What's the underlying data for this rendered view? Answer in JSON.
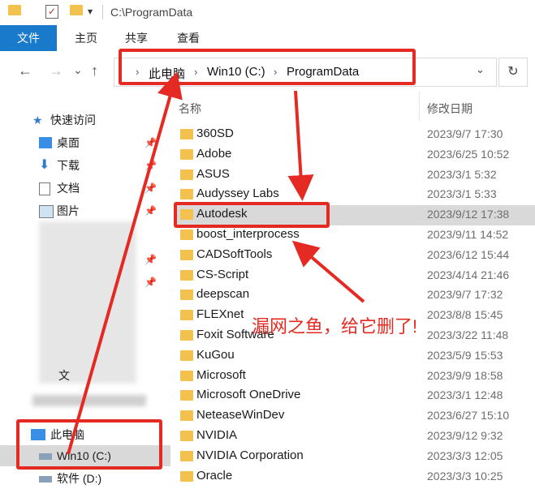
{
  "titlebar": {
    "path": "C:\\ProgramData"
  },
  "ribbon": {
    "tabs": [
      "文件",
      "主页",
      "共享",
      "查看"
    ]
  },
  "nav": {
    "back": "←",
    "forward": "→",
    "dropdown": "⌄",
    "up": "↑",
    "breadcrumbs": [
      "此电脑",
      "Win10 (C:)",
      "ProgramData"
    ],
    "refresh": "↻"
  },
  "sidebar": {
    "quick_access": "快速访问",
    "items": [
      "桌面",
      "下载",
      "文档",
      "图片"
    ],
    "this_pc": "此电脑",
    "drives": [
      "Win10 (C:)",
      "软件 (D:)"
    ],
    "partial_text": "文"
  },
  "columns": {
    "name": "名称",
    "date": "修改日期"
  },
  "files": [
    {
      "name": "360SD",
      "date": "2023/9/7 17:30"
    },
    {
      "name": "Adobe",
      "date": "2023/6/25 10:52"
    },
    {
      "name": "ASUS",
      "date": "2023/3/1 5:32"
    },
    {
      "name": "Audyssey Labs",
      "date": "2023/3/1 5:33"
    },
    {
      "name": "Autodesk",
      "date": "2023/9/12 17:38"
    },
    {
      "name": "boost_interprocess",
      "date": "2023/9/11 14:52"
    },
    {
      "name": "CADSoftTools",
      "date": "2023/6/12 15:44"
    },
    {
      "name": "CS-Script",
      "date": "2023/4/14 21:46"
    },
    {
      "name": "deepscan",
      "date": "2023/9/7 17:32"
    },
    {
      "name": "FLEXnet",
      "date": "2023/8/8 15:45"
    },
    {
      "name": "Foxit Software",
      "date": "2023/3/22 11:48"
    },
    {
      "name": "KuGou",
      "date": "2023/5/9 15:53"
    },
    {
      "name": "Microsoft",
      "date": "2023/9/9 18:58"
    },
    {
      "name": "Microsoft OneDrive",
      "date": "2023/3/1 12:48"
    },
    {
      "name": "NeteaseWinDev",
      "date": "2023/6/27 15:10"
    },
    {
      "name": "NVIDIA",
      "date": "2023/9/12 9:32"
    },
    {
      "name": "NVIDIA Corporation",
      "date": "2023/3/3 12:05"
    },
    {
      "name": "Oracle",
      "date": "2023/3/3 10:25"
    }
  ],
  "annotation": {
    "text": "漏网之鱼，给它删了!",
    "color": "#e42a22"
  },
  "colors": {
    "accent": "#1979ca",
    "folder": "#f3c24e",
    "highlight": "#d9d9d9"
  }
}
